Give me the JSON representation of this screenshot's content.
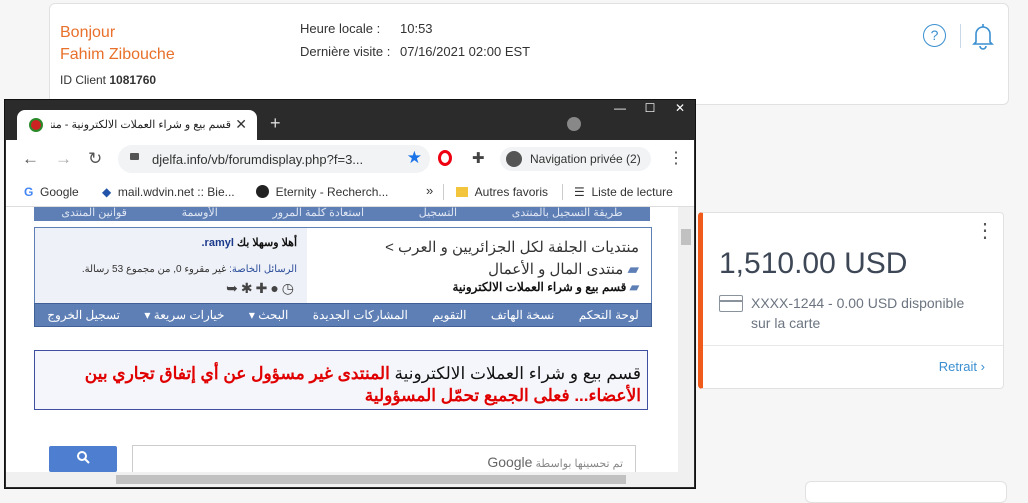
{
  "header": {
    "greeting": "Bonjour",
    "user_name": "Fahim Zibouche",
    "client_id_label": "ID Client",
    "client_id": "1081760",
    "local_time_label": "Heure locale :",
    "local_time": "10:53",
    "last_visit_label": "Dernière visite :",
    "last_visit": "07/16/2021 02:00 EST",
    "help_icon": "?"
  },
  "account_card": {
    "amount": "1,510.00 USD",
    "card_info": "XXXX-1244 - 0.00 USD disponible sur la carte",
    "withdraw_label": "Retrait",
    "menu": "⋮",
    "accent_color": "#f05a1a"
  },
  "browser": {
    "tab_title": "قسم بيع و شراء العملات الالكترونية - منتديا",
    "url": "djelfa.info/vb/forumdisplay.php?f=3...",
    "private_label": "Navigation privée (2)",
    "bookmarks": [
      "Google",
      "mail.wdvin.net :: Bie...",
      "Eternity - Recherch...",
      "»",
      "Autres favoris",
      "Liste de lecture"
    ]
  },
  "forum": {
    "top_links": [
      "طريقة التسجيل بالمنتدى",
      "التسجيل",
      "استعادة كلمة المرور",
      "الأوسمة",
      "قوانين المنتدى"
    ],
    "breadcrumb_1": "منتديات الجلفة لكل الجزائريين و العرب >",
    "breadcrumb_2": "منتدى المال و الأعمال",
    "breadcrumb_3": "قسم بيع و شراء العملات الالكترونية",
    "welcome_prefix": "أهلا وسهلا بك",
    "welcome_user": "ramyl.",
    "pm_link": "الرسائل الخاصة:",
    "pm_text": "غير مقروء 0, من مجموع 53 رسالة.",
    "nav_links": [
      "لوحة التحكم",
      "نسخة الهاتف",
      "التقويم",
      "المشاركات الجديدة",
      "البحث ▾",
      "خيارات سريعة ▾",
      "تسجيل الخروج"
    ],
    "notice_black": "قسم بيع و شراء العملات الالكترونية",
    "notice_red": "المنتدى غير مسؤول عن أي إتفاق تجاري بين الأعضاء... فعلى الجميع تحمّل المسؤولية",
    "search_hint": "تم تحسينها بواسطة",
    "search_brand": "Google"
  }
}
